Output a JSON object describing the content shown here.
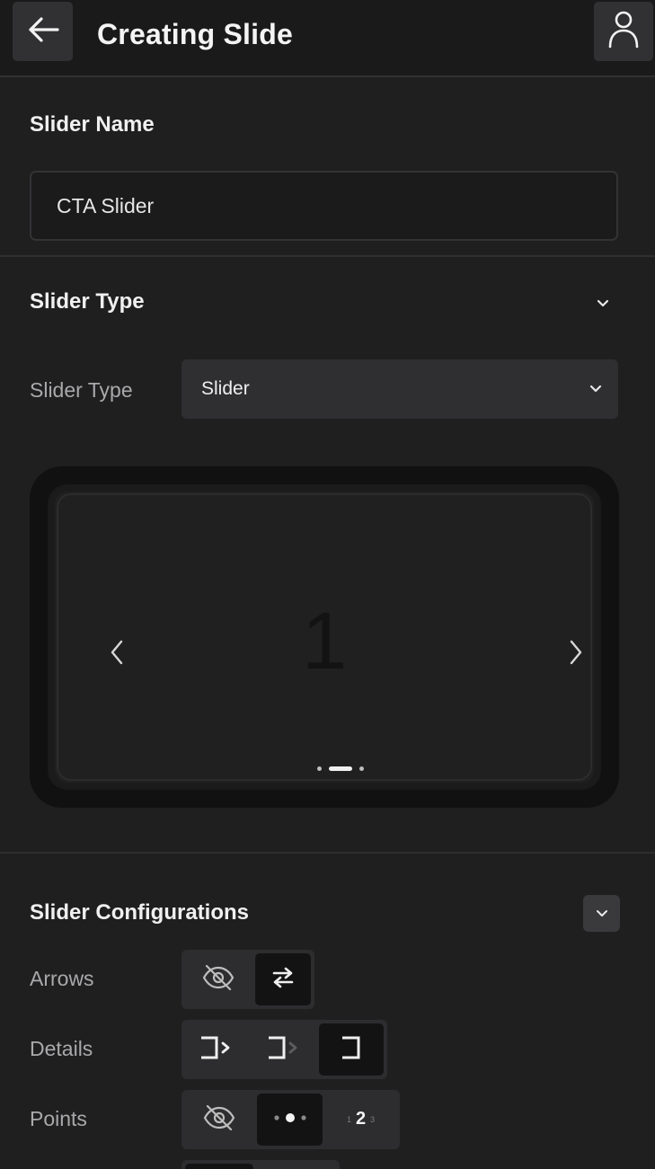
{
  "header": {
    "title": "Creating Slide",
    "back_icon": "arrow-left-icon",
    "profile_icon": "user-icon"
  },
  "slider_name": {
    "label": "Slider Name",
    "value": "CTA Slider"
  },
  "slider_type_section": {
    "title": "Slider Type",
    "field_label": "Slider Type",
    "selected": "Slider",
    "preview": {
      "slide_number": "1",
      "active_dot": 2,
      "dot_count": 3
    }
  },
  "config": {
    "title": "Slider Configurations",
    "rows": [
      {
        "label": "Arrows",
        "options": [
          "hidden",
          "arrows"
        ],
        "active": 1
      },
      {
        "label": "Details",
        "options": [
          "details-arrow",
          "details-faded-arrow",
          "details-none"
        ],
        "active": 2
      },
      {
        "label": "Points",
        "options": [
          "hidden",
          "dots",
          "numbers"
        ],
        "active": 1
      }
    ]
  },
  "colors": {
    "background": "#1f1f20",
    "surface": "#2f2f31",
    "active_segment": "#131314",
    "text": "#f2f2f2",
    "muted_text": "#a9a9ab"
  }
}
